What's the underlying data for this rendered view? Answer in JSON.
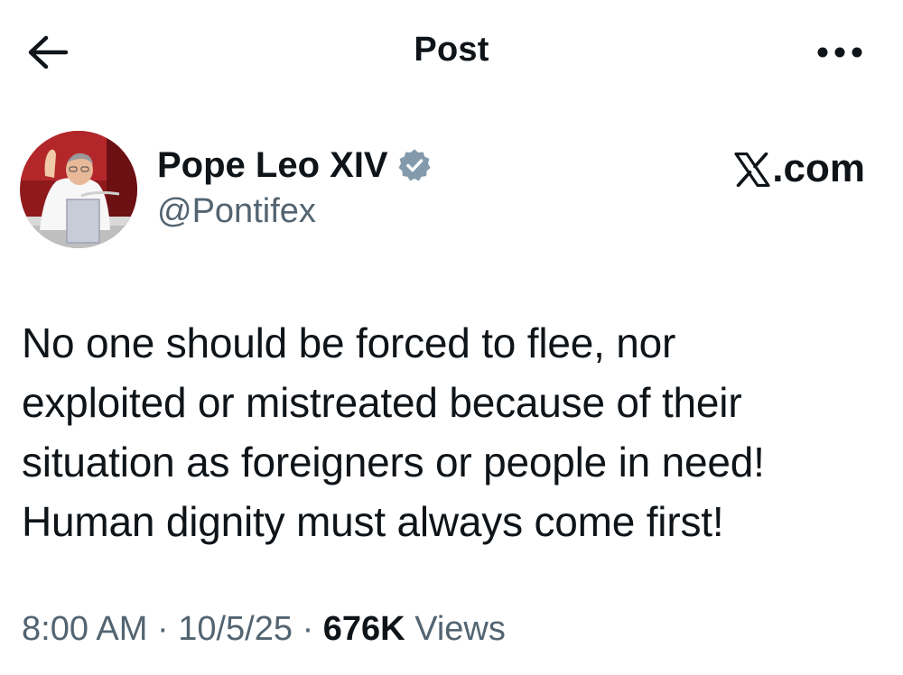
{
  "header": {
    "title": "Post",
    "back_icon": "arrow-left-icon",
    "more_icon": "more-horizontal-icon"
  },
  "author": {
    "name": "Pope Leo XIV",
    "handle": "@Pontifex",
    "verified_icon": "verified-badge-icon",
    "verified_color": "#829aab"
  },
  "watermark": {
    "logo_icon": "x-logo-icon",
    "text": ".com"
  },
  "post": {
    "lines": [
      "No one should be forced to flee, nor",
      "exploited or mistreated because of their",
      "situation as foreigners or people in need!",
      "Human dignity must always come first!"
    ]
  },
  "meta": {
    "time": "8:00 AM",
    "separator": "·",
    "date": "10/5/25",
    "views_count": "676K",
    "views_label": "Views"
  },
  "colors": {
    "text_primary": "#0f1419",
    "text_secondary": "#536471",
    "background": "#ffffff"
  }
}
